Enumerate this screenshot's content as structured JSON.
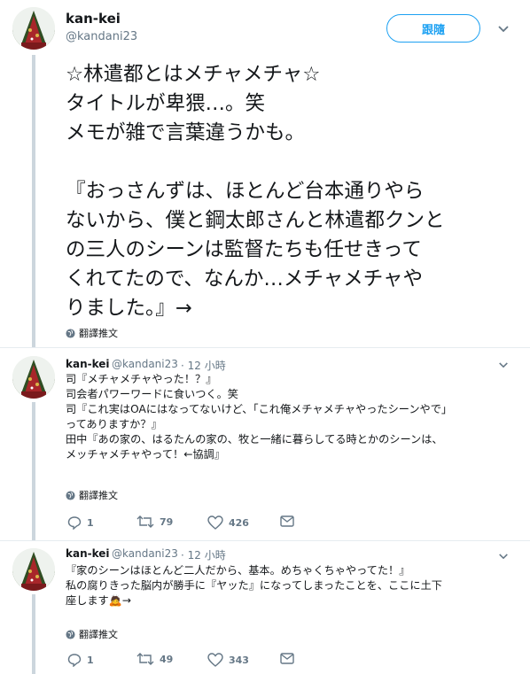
{
  "main_tweet": {
    "author_name": "kan-kei",
    "author_handle": "@kandani23",
    "follow_label": "跟隨",
    "text": "☆林遣都とはメチャメチャ☆\nタイトルが卑猥…。笑\nメモが雑で言葉違うかも。\n\n『おっさんずは、ほとんど台本通りやら\nないから、僕と鋼太郎さんと林遣都クンと\nの三人のシーンは監督たちも任せきって\nくれてたので、なんか…メチャメチャや\nりました。』→",
    "translate_label": "翻譯推文"
  },
  "replies": [
    {
      "author_name": "kan-kei",
      "author_handle": "@kandani23",
      "time": "· 12 小時",
      "text": "司『メチャメチャやった！？』\n司会者パワーワードに食いつく。笑\n司『これ実はOAにはなってないけど、「これ俺メチャメチャやったシーンやで」\nってありますか？』\n田中『あの家の、はるたんの家の、牧と一緒に暮らしてる時とかのシーンは、\nメッチャメチャやって！←協調』",
      "translate_label": "翻譯推文",
      "reply_count": "1",
      "retweet_count": "79",
      "like_count": "426"
    },
    {
      "author_name": "kan-kei",
      "author_handle": "@kandani23",
      "time": "· 12 小時",
      "text": "『家のシーンはほとんど二人だから、基本。めちゃくちゃやってた！』\n私の腐りきった脳内が勝手に『ヤッた』になってしまったことを、ここに土下\n座します🙇→",
      "translate_label": "翻譯推文",
      "reply_count": "1",
      "retweet_count": "49",
      "like_count": "343"
    }
  ],
  "icons": {
    "caret": "chevron-down-icon",
    "globe": "globe-icon",
    "reply": "reply-icon",
    "retweet": "retweet-icon",
    "like": "heart-icon",
    "dm": "envelope-icon"
  },
  "colors": {
    "accent": "#1da1f2",
    "text": "#14171a",
    "secondary": "#657786",
    "thread_line": "#ccd6dd"
  }
}
